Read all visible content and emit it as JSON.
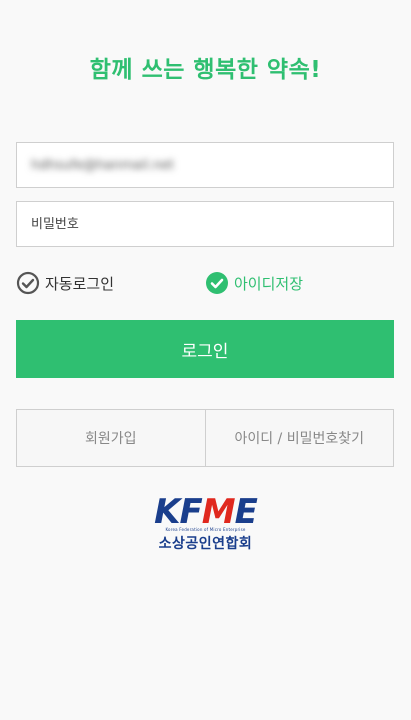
{
  "header": {
    "title": "함께 쓰는 행복한 약속!"
  },
  "form": {
    "email_value": "hdhsufe@hanmail.net",
    "password_placeholder": "비밀번호",
    "auto_login_label": "자동로그인",
    "auto_login_checked": false,
    "save_id_label": "아이디저장",
    "save_id_checked": true,
    "login_button_label": "로그인"
  },
  "footer_buttons": {
    "signup_label": "회원가입",
    "find_label": "아이디 / 비밀번호찾기"
  },
  "logo": {
    "mark_k": "K",
    "mark_f": "F",
    "mark_m": "M",
    "mark_e": "E",
    "subtitle": "Korea Federation of Micro Enterprise",
    "korean_name": "소상공인연합회"
  },
  "colors": {
    "accent": "#2fbf71",
    "logo_blue": "#1a3e8c",
    "logo_red": "#e0281e"
  },
  "icons": {
    "auto_login": "check-circle-outline-icon",
    "save_id": "check-circle-filled-icon"
  }
}
